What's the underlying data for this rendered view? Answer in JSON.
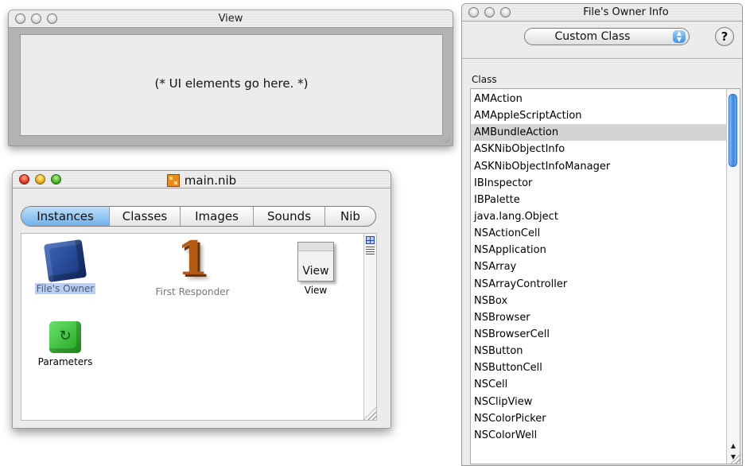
{
  "view_window": {
    "title": "View",
    "placeholder": "(* UI elements go here. *)"
  },
  "nib_window": {
    "title": "main.nib",
    "tabs": [
      {
        "label": "Instances",
        "active": true
      },
      {
        "label": "Classes",
        "active": false
      },
      {
        "label": "Images",
        "active": false
      },
      {
        "label": "Sounds",
        "active": false
      },
      {
        "label": "Nib",
        "active": false
      }
    ],
    "instances": [
      {
        "label": "File's Owner",
        "icon": "blue-cube-icon",
        "selected": true
      },
      {
        "label": "First Responder",
        "icon": "first-responder-icon",
        "selected": false
      },
      {
        "label": "View",
        "icon": "view-object-icon",
        "selected": false
      },
      {
        "label": "Parameters",
        "icon": "green-cube-icon",
        "selected": false
      }
    ],
    "view_object_icon_text": "View",
    "first_responder_glyph": "1",
    "parameters_glyph": "↻"
  },
  "info_window": {
    "title": "File's Owner Info",
    "popup_value": "Custom Class",
    "help_label": "?",
    "class_header": "Class",
    "classes": [
      "AMAction",
      "AMAppleScriptAction",
      "AMBundleAction",
      "ASKNibObjectInfo",
      "ASKNibObjectInfoManager",
      "IBInspector",
      "IBPalette",
      "java.lang.Object",
      "NSActionCell",
      "NSApplication",
      "NSArray",
      "NSArrayController",
      "NSBox",
      "NSBrowser",
      "NSBrowserCell",
      "NSButton",
      "NSButtonCell",
      "NSCell",
      "NSClipView",
      "NSColorPicker",
      "NSColorWell"
    ],
    "selected_class": "AMBundleAction"
  },
  "colors": {
    "selection_blue": "#b9cef1",
    "tab_active": "#6fb0ea",
    "list_selection": "#d4d4d4"
  }
}
